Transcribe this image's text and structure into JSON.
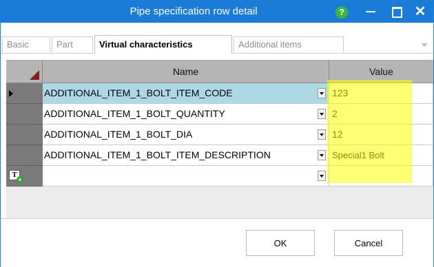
{
  "window": {
    "title": "Pipe specification row detail",
    "help_icon_text": "?",
    "close_glyph": "✕"
  },
  "tabs": [
    {
      "label": "Basic",
      "active": false
    },
    {
      "label": "Part",
      "active": false
    },
    {
      "label": "Virtual characteristics",
      "active": true
    },
    {
      "label": "Additional items",
      "active": false
    }
  ],
  "grid": {
    "columns": {
      "name": "Name",
      "value": "Value"
    },
    "rows": [
      {
        "name": "ADDITIONAL_ITEM_1_BOLT_ITEM_CODE",
        "value": "123",
        "selected": true
      },
      {
        "name": "ADDITIONAL_ITEM_1_BOLT_QUANTITY",
        "value": "2",
        "selected": false
      },
      {
        "name": "ADDITIONAL_ITEM_1_BOLT_DIA",
        "value": "12",
        "selected": false
      },
      {
        "name": "ADDITIONAL_ITEM_1_BOLT_ITEM_DESCRIPTION",
        "value": "Special1 Bolt",
        "selected": false
      }
    ],
    "new_row_icon_text": "T"
  },
  "buttons": {
    "ok": "OK",
    "cancel": "Cancel"
  },
  "colors": {
    "titlebar": "#1a7bd9",
    "selection": "#add8e6",
    "highlight": "#ffff00"
  }
}
